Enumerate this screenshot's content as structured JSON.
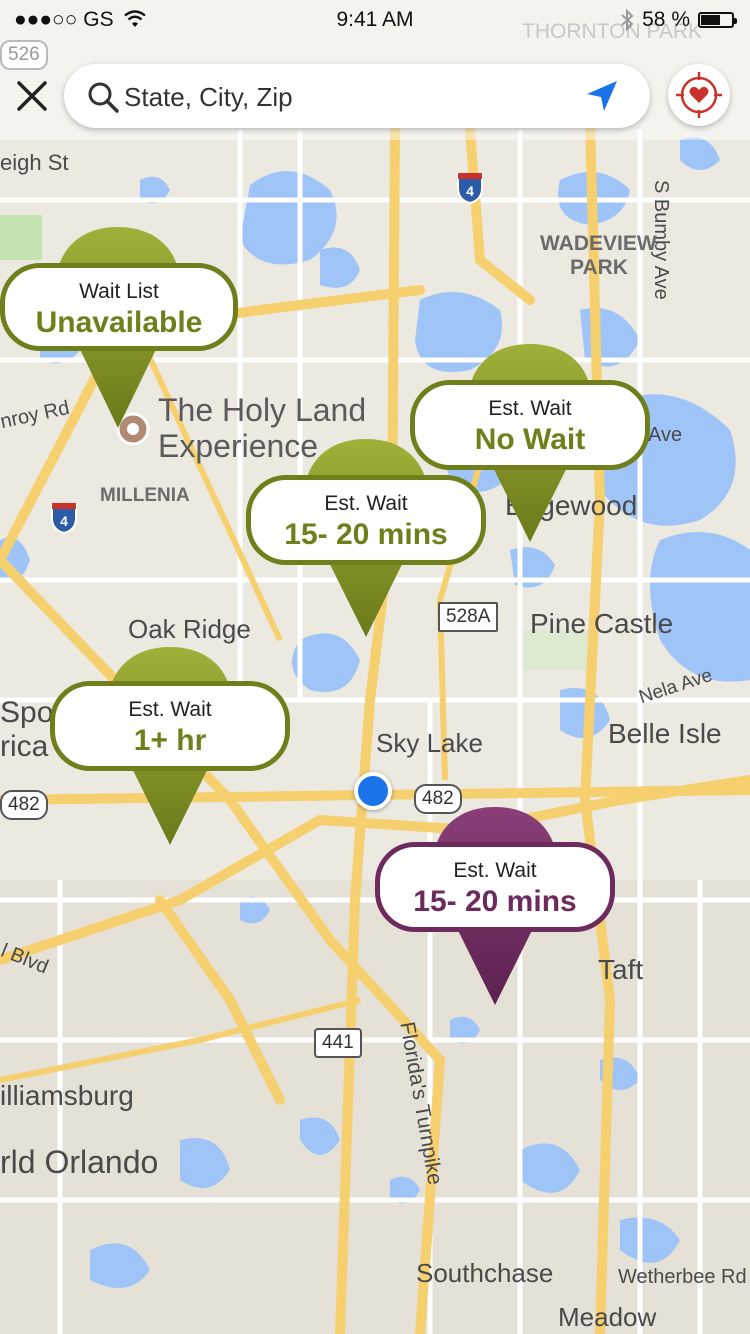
{
  "status_bar": {
    "carrier": "●●●○○ GS",
    "time": "9:41 AM",
    "battery": "58 %",
    "battery_level": 0.58
  },
  "search": {
    "placeholder": "State, City, Zip",
    "value": ""
  },
  "icons": {
    "close": "close-icon",
    "search": "search-icon",
    "locate": "location-arrow-icon",
    "favorites": "heart-target-icon",
    "user_location": "user-location-dot"
  },
  "colors": {
    "green_pin": "#7a8a23",
    "purple_pin": "#6d2a5c",
    "user_dot": "#1a73e8",
    "water": "#9fc5f8",
    "road": "#f6d57a"
  },
  "pins": [
    {
      "line1": "Wait List",
      "line2": "Unavailable",
      "color": "green"
    },
    {
      "line1": "Est. Wait",
      "line2": "No Wait",
      "color": "green"
    },
    {
      "line1": "Est. Wait",
      "line2": "15- 20 mins",
      "color": "green"
    },
    {
      "line1": "Est. Wait",
      "line2": "1+ hr",
      "color": "green"
    },
    {
      "line1": "Est. Wait",
      "line2": "15- 20 mins",
      "color": "purple"
    }
  ],
  "map_labels": {
    "thornton_park": "THORNTON PARK",
    "eigh_st": "eigh St",
    "bumby": "S Bumby Ave",
    "wadeview": "WADEVIEW",
    "wadeview2": "PARK",
    "holy_land": "The Holy Land",
    "holy_land2": "Experience",
    "conroy": "nroy Rd",
    "millenia": "MILLENIA",
    "edgewood": "Edgewood",
    "ave": "Ave",
    "oak_ridge": "Oak Ridge",
    "pine_castle": "Pine Castle",
    "nela": "Nela Ave",
    "belle_isle": "Belle Isle",
    "sky_lake": "Sky Lake",
    "spo": "Spo",
    "rica": "rica",
    "blvd": "l Blvd",
    "taft": "Taft",
    "williamsburg": "illiamsburg",
    "orlando": "rld Orlando",
    "turnpike": "Florida's Turnpike",
    "southchase": "Southchase",
    "wetherbee": "Wetherbee Rd",
    "meadow": "Meadow"
  },
  "shields": {
    "s526": "526",
    "s4a": "4",
    "s4b": "4",
    "s528a": "528A",
    "s482a": "482",
    "s482b": "482",
    "s441": "441"
  }
}
